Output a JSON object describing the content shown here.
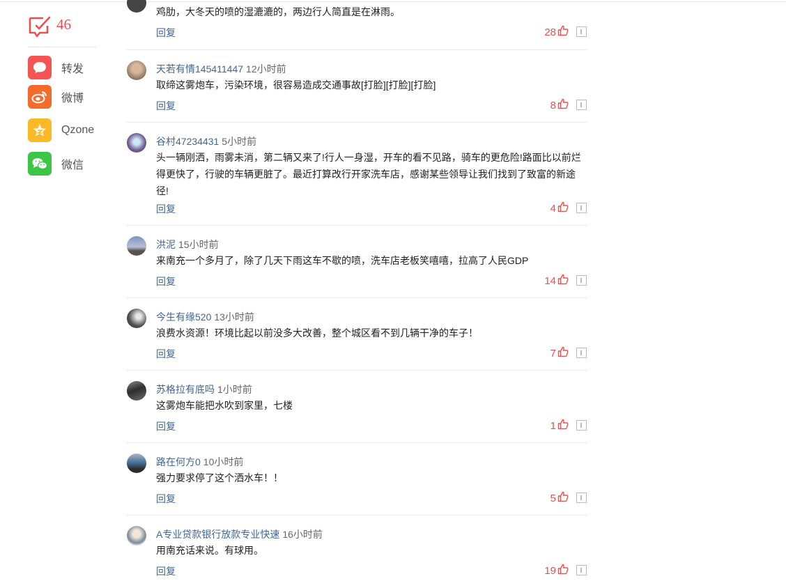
{
  "sidebar": {
    "comment_count": "46",
    "share": [
      {
        "name": "share-forward",
        "label": "转发",
        "color": "#f35454",
        "icon": "chat-bubble-icon"
      },
      {
        "name": "share-weibo",
        "label": "微博",
        "color": "#f36c2c",
        "icon": "weibo-icon"
      },
      {
        "name": "share-qzone",
        "label": "Qzone",
        "color": "#fbb827",
        "icon": "qzone-star-icon"
      },
      {
        "name": "share-wechat",
        "label": "微信",
        "color": "#3cc645",
        "icon": "wechat-icon"
      }
    ]
  },
  "comments": [
    {
      "user": "",
      "time": "",
      "text": "鸡肋，大冬天的喷的湿漉漉的，两边行人简直是在淋雨。",
      "reply": "回复",
      "likes": "28"
    },
    {
      "user": "天若有情145411447",
      "time": "12小时前",
      "text": "取缔这雾炮车，污染环境，很容易造成交通事故[打脸][打脸][打脸]",
      "reply": "回复",
      "likes": "8"
    },
    {
      "user": "谷村47234431",
      "time": "5小时前",
      "text": "头一辆刚洒，雨雾未消，第二辆又来了!行人一身湿，开车的看不见路，骑车的更危险!路面比以前烂得更快了，行驶的车辆更脏了。最近打算改行开家洗车店，感谢某些领导让我们找到了致富的新途径!",
      "reply": "回复",
      "likes": "4"
    },
    {
      "user": "洪泥",
      "time": "15小时前",
      "text": "来南充一个多月了，除了几天下雨这车不歇的喷，洗车店老板笑嘻嘻，拉高了人民GDP",
      "reply": "回复",
      "likes": "14"
    },
    {
      "user": "今生有缘520",
      "time": "13小时前",
      "text": "浪费水资源！环境比起以前没多大改善，整个城区看不到几辆干净的车子！",
      "reply": "回复",
      "likes": "7"
    },
    {
      "user": "苏格拉有底吗",
      "time": "1小时前",
      "text": "这雾炮车能把水吹到家里，七楼",
      "reply": "回复",
      "likes": "1"
    },
    {
      "user": "路在何方0",
      "time": "10小时前",
      "text": "强力要求停了这个洒水车！！",
      "reply": "回复",
      "likes": "5"
    },
    {
      "user": "A专业贷款银行放款专业快速",
      "time": "16小时前",
      "text": "用南充话来说。有球用。",
      "reply": "回复",
      "likes": "19"
    }
  ]
}
